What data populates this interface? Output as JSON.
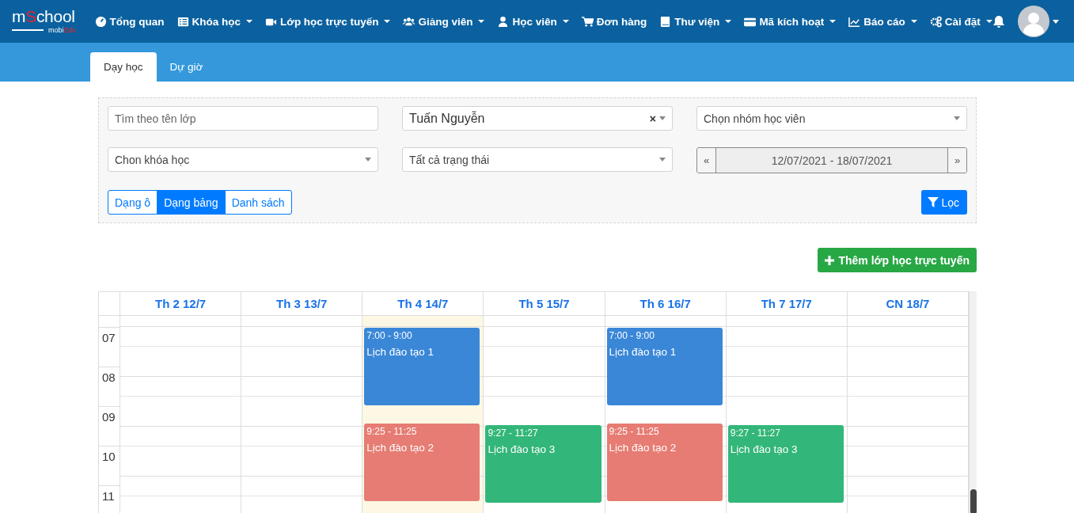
{
  "navbar": {
    "logo": {
      "main": [
        {
          "text": "m",
          "accent": false
        },
        {
          "text": "S",
          "accent": true
        },
        {
          "text": "chool",
          "accent": false
        }
      ],
      "sub": [
        {
          "text": "mobi",
          "accent": false
        },
        {
          "text": "Edu",
          "accent": true
        }
      ]
    },
    "items": [
      {
        "label": "Tổng quan",
        "dropdown": false
      },
      {
        "label": "Khóa học",
        "dropdown": true
      },
      {
        "label": "Lớp học trực tuyến",
        "dropdown": true
      },
      {
        "label": "Giảng viên",
        "dropdown": true
      },
      {
        "label": "Học viên",
        "dropdown": true
      },
      {
        "label": "Đơn hàng",
        "dropdown": false
      },
      {
        "label": "Thư viện",
        "dropdown": true
      },
      {
        "label": "Mã kích hoạt",
        "dropdown": true
      },
      {
        "label": "Báo cáo",
        "dropdown": true
      },
      {
        "label": "Cài đặt",
        "dropdown": true
      }
    ]
  },
  "tabs": [
    {
      "label": "Dạy học",
      "selected": true
    },
    {
      "label": "Dự giờ",
      "selected": false
    }
  ],
  "filters": {
    "search": {
      "placeholder": "Tìm theo tên lớp"
    },
    "teacher": {
      "value": "Tuấn Nguyễn",
      "clear": "×"
    },
    "group": {
      "value": "Chọn nhóm học viên"
    },
    "course": {
      "value": "Chon khóa học"
    },
    "status": {
      "value": "Tất cả trạng thái"
    },
    "date_range": {
      "prev": "«",
      "value": "12/07/2021 - 18/07/2021",
      "next": "»"
    },
    "view_modes": [
      {
        "label": "Dạng ô",
        "selected": false
      },
      {
        "label": "Dạng bảng",
        "selected": true
      },
      {
        "label": "Danh sách",
        "selected": false
      }
    ],
    "filter_button": "Lọc"
  },
  "add_button": "Thêm lớp học trực tuyến",
  "calendar": {
    "hours": [
      "07",
      "08",
      "09",
      "10",
      "11"
    ],
    "days": [
      {
        "label": "Th 2 12/7",
        "today": false
      },
      {
        "label": "Th 3 13/7",
        "today": false
      },
      {
        "label": "Th 4 14/7",
        "today": true,
        "events": [
          {
            "time": "7:00 - 9:00",
            "title": "Lịch đào tạo 1",
            "color": "#3a87d8"
          },
          {
            "time": "9:25 - 11:25",
            "title": "Lịch đào tạo 2",
            "color": "#e67c73"
          }
        ]
      },
      {
        "label": "Th 5 15/7",
        "today": false,
        "events": [
          {
            "time": "9:27 - 11:27",
            "title": "Lịch đào tạo 3",
            "color": "#33b679"
          }
        ]
      },
      {
        "label": "Th 6 16/7",
        "today": false,
        "events": [
          {
            "time": "7:00 - 9:00",
            "title": "Lịch đào tạo 1",
            "color": "#3a87d8"
          },
          {
            "time": "9:25 - 11:25",
            "title": "Lịch đào tạo 2",
            "color": "#e67c73"
          }
        ]
      },
      {
        "label": "Th 7 17/7",
        "today": false,
        "events": [
          {
            "time": "9:27 - 11:27",
            "title": "Lịch đào tạo 3",
            "color": "#33b679"
          }
        ]
      },
      {
        "label": "CN 18/7",
        "today": false
      }
    ]
  }
}
